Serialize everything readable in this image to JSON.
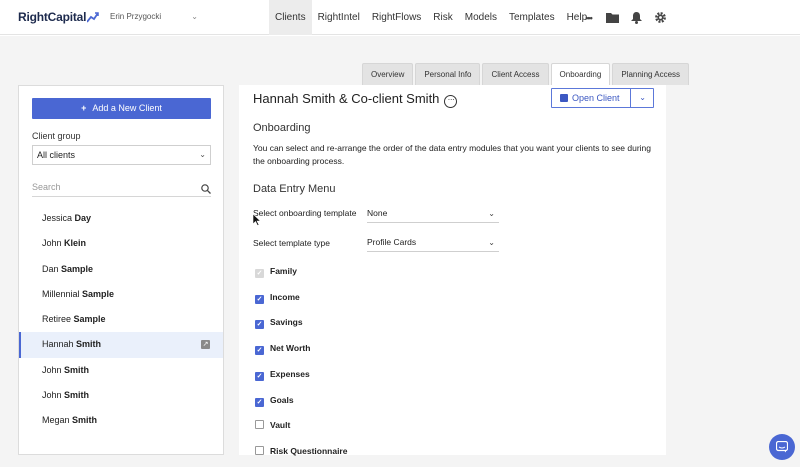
{
  "app": {
    "logo_text": "RightCapital",
    "user_name": "Erin Przygocki"
  },
  "nav": {
    "items": [
      {
        "label": "Clients",
        "active": true
      },
      {
        "label": "RightIntel",
        "active": false
      },
      {
        "label": "RightFlows",
        "active": false
      },
      {
        "label": "Risk",
        "active": false
      },
      {
        "label": "Models",
        "active": false
      },
      {
        "label": "Templates",
        "active": false
      },
      {
        "label": "Help",
        "active": false
      }
    ],
    "icons": [
      "more-icon",
      "folder-icon",
      "bell-icon",
      "gear-icon"
    ],
    "more_glyph": "•••"
  },
  "tabs": [
    {
      "label": "Overview",
      "active": false
    },
    {
      "label": "Personal Info",
      "active": false
    },
    {
      "label": "Client Access",
      "active": false
    },
    {
      "label": "Onboarding",
      "active": true
    },
    {
      "label": "Planning Access",
      "active": false
    }
  ],
  "sidebar": {
    "add_button_label": "Add a New Client",
    "client_group_label": "Client group",
    "client_group_value": "All clients",
    "search_placeholder": "Search",
    "clients": [
      {
        "first": "Jessica",
        "last": "Day",
        "active": false
      },
      {
        "first": "John",
        "last": "Klein",
        "active": false
      },
      {
        "first": "Dan",
        "last": "Sample",
        "active": false
      },
      {
        "first": "Millennial",
        "last": "Sample",
        "active": false
      },
      {
        "first": "Retiree",
        "last": "Sample",
        "active": false
      },
      {
        "first": "Hannah",
        "last": "Smith",
        "active": true
      },
      {
        "first": "John",
        "last": "Smith",
        "active": false
      },
      {
        "first": "John",
        "last": "Smith",
        "active": false
      },
      {
        "first": "Megan",
        "last": "Smith",
        "active": false
      }
    ]
  },
  "main": {
    "client_name": "Hannah Smith & Co-client Smith",
    "open_client_label": "Open Client",
    "onboarding_title": "Onboarding",
    "onboarding_desc": "You can select and re-arrange the order of the data entry modules that you want your clients to see during the onboarding process.",
    "data_entry_title": "Data Entry Menu",
    "template_label": "Select onboarding template",
    "template_value": "None",
    "template_type_label": "Select template type",
    "template_type_value": "Profile Cards",
    "modules": [
      {
        "label": "Family",
        "state": "disabled"
      },
      {
        "label": "Income",
        "state": "checked"
      },
      {
        "label": "Savings",
        "state": "checked"
      },
      {
        "label": "Net Worth",
        "state": "checked"
      },
      {
        "label": "Expenses",
        "state": "checked"
      },
      {
        "label": "Goals",
        "state": "checked"
      },
      {
        "label": "Vault",
        "state": "unchecked"
      },
      {
        "label": "Risk Questionnaire",
        "state": "unchecked"
      }
    ]
  },
  "colors": {
    "accent": "#4a67d3",
    "page_background": "#f4f4f4",
    "active_row": "#eaf0fb"
  }
}
